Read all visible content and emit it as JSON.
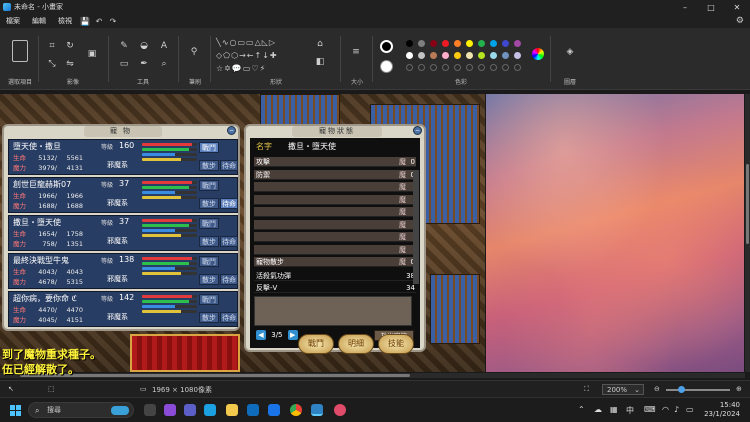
{
  "window": {
    "title": "未命名 - 小畫家",
    "minimize": "–",
    "maximize": "□",
    "close": "✕"
  },
  "menu": {
    "items": [
      "檔案",
      "編輯",
      "檢視"
    ],
    "save": "💾",
    "undo": "↶",
    "redo": "↷",
    "settings": "⚙"
  },
  "ribbon": {
    "groups": [
      "選取項目",
      "影像",
      "工具",
      "筆刷",
      "形狀",
      "大小",
      "色彩",
      "圖層"
    ],
    "colors": [
      "#000000",
      "#7f7f7f",
      "#880015",
      "#ed1c24",
      "#ff7f27",
      "#fff200",
      "#22b14c",
      "#00a2e8",
      "#3f48cc",
      "#a349a4",
      "#ffffff",
      "#c3c3c3",
      "#b97a57",
      "#ffaec9",
      "#ffc90e",
      "#efe4b0",
      "#b5e61d",
      "#99d9ea",
      "#7092be",
      "#c8bfe7"
    ],
    "color1": "#000000",
    "color2": "#ffffff"
  },
  "pet_panel": {
    "title": "寵物",
    "level_label": "等級",
    "hp_label": "生命",
    "mp_label": "魔力",
    "pets": [
      {
        "name": "墮天使・撒旦",
        "level": "160",
        "hp": "5132/",
        "hp_max": "5561",
        "mp": "3979/",
        "mp_max": "4131",
        "attr": "邪魔系",
        "btn1": "戰鬥",
        "btn2": "散步",
        "btn3": "待命",
        "active": "btn1"
      },
      {
        "name": "創世巨龍赫斯07",
        "level": "37",
        "hp": "1966/",
        "hp_max": "1966",
        "mp": "1688/",
        "mp_max": "1688",
        "attr": "邪魔系",
        "btn1": "戰鬥",
        "btn2": "散步",
        "btn3": "待命",
        "active": "btn3"
      },
      {
        "name": "撒旦・墮天使",
        "level": "37",
        "hp": "1654/",
        "hp_max": "1758",
        "mp": "758/",
        "mp_max": "1351",
        "attr": "邪魔系",
        "btn1": "戰鬥",
        "btn2": "散步",
        "btn3": "待命",
        "active": ""
      },
      {
        "name": "最終決戰型牛鬼",
        "level": "138",
        "hp": "4043/",
        "hp_max": "4043",
        "mp": "4678/",
        "mp_max": "5315",
        "attr": "邪魔系",
        "btn1": "戰鬥",
        "btn2": "散步",
        "btn3": "待命",
        "active": ""
      },
      {
        "name": "超你病，要你命 ℭ",
        "level": "142",
        "hp": "4470/",
        "hp_max": "4470",
        "mp": "4045/",
        "mp_max": "4151",
        "attr": "邪魔系",
        "btn1": "戰鬥",
        "btn2": "散步",
        "btn3": "待命",
        "active": ""
      }
    ]
  },
  "status_panel": {
    "title": "寵物狀態",
    "name_label": "名字",
    "name": "撒旦・墮天使",
    "skills": [
      {
        "name": "攻擊",
        "mo": "魔",
        "cost": "0"
      },
      {
        "name": "防禦",
        "mo": "魔",
        "cost": "0"
      },
      {
        "name": "",
        "mo": "魔",
        "cost": ""
      },
      {
        "name": "",
        "mo": "魔",
        "cost": ""
      },
      {
        "name": "",
        "mo": "魔",
        "cost": ""
      },
      {
        "name": "",
        "mo": "魔",
        "cost": ""
      },
      {
        "name": "",
        "mo": "魔",
        "cost": ""
      },
      {
        "name": "",
        "mo": "魔",
        "cost": ""
      },
      {
        "name": "寵物散步",
        "mo": "魔",
        "cost": "0"
      }
    ],
    "extra": [
      {
        "name": "活殺氣功彈",
        "cost": "38"
      },
      {
        "name": "反擊-V",
        "cost": "34"
      }
    ],
    "page": "3/5",
    "prev": "◀",
    "next": "▶",
    "release": "放出寵物",
    "btn_battle": "戰鬥",
    "btn_rename": "明細",
    "btn_skill": "技能"
  },
  "game_messages": [
    "到了魔物重求種子。",
    "伍已經解散了。"
  ],
  "statusbar": {
    "dimensions": "1969 × 1080像素",
    "zoom": "200%"
  },
  "taskbar": {
    "search_placeholder": "搜尋",
    "time": "15:40",
    "date": "23/1/2024",
    "ime": "中"
  }
}
